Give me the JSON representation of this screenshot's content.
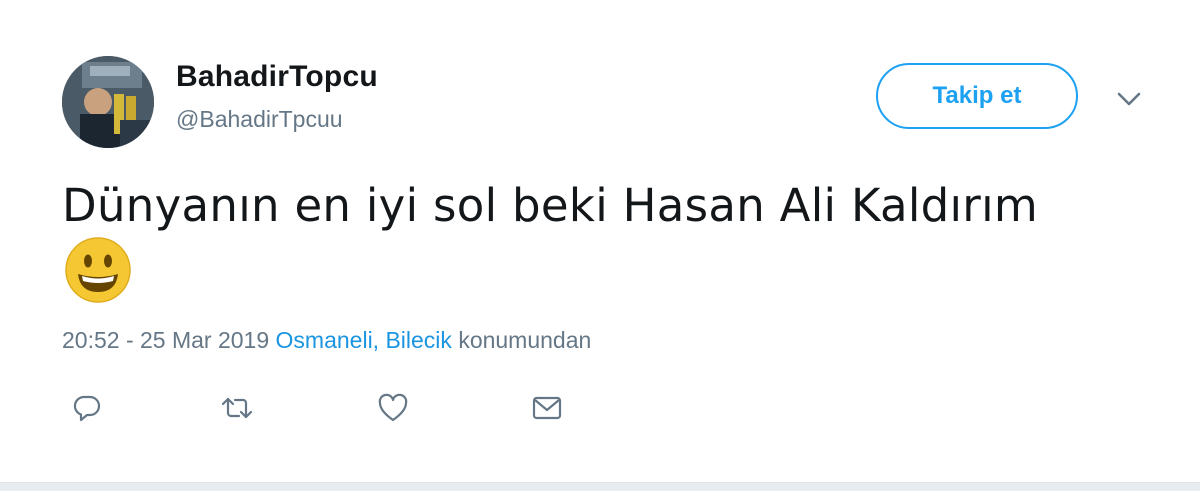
{
  "user": {
    "display_name": "BahadirTopcu",
    "handle": "@BahadirTpcuu"
  },
  "follow_button": {
    "label": "Takip et"
  },
  "tweet": {
    "text": "Dünyanın en iyi sol beki Hasan Ali Kaldırım",
    "emoji": "smiling-face-emoji"
  },
  "meta": {
    "time_date": "20:52 - 25 Mar 2019",
    "location": "Osmaneli, Bilecik",
    "location_suffix": "konumundan"
  },
  "actions": [
    "reply-icon",
    "retweet-icon",
    "like-icon",
    "message-icon"
  ],
  "colors": {
    "accent": "#1da1f2",
    "link": "#1b95e0",
    "secondary_text": "#657786",
    "primary_text": "#14171a"
  }
}
